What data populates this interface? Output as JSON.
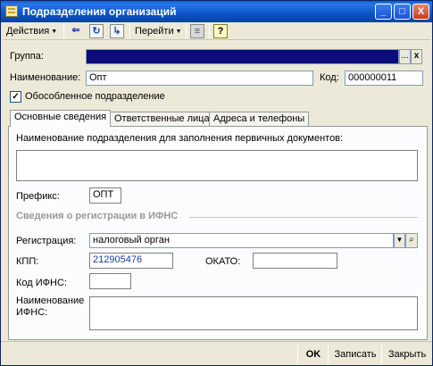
{
  "window": {
    "title": "Подразделения организаций",
    "minimize": "_",
    "maximize": "□",
    "close": "X"
  },
  "toolbar": {
    "actions_label": "Действия",
    "goto_label": "Перейти",
    "help_label": "?",
    "icons": [
      "arrow-left-icon",
      "refresh-icon",
      "structure-icon",
      "list-icon",
      "help-icon"
    ]
  },
  "form": {
    "group_label": "Группа:",
    "group_value": "",
    "group_select_btn": "...",
    "group_clear_btn": "x",
    "name_label": "Наименование:",
    "name_value": "Опт",
    "code_label": "Код:",
    "code_value": "000000011",
    "separate_checkbox_label": "Обособленное подразделение",
    "separate_checked": true
  },
  "tabs": [
    {
      "label": "Основные сведения"
    },
    {
      "label": "Ответственные лица"
    },
    {
      "label": "Адреса и телефоны"
    }
  ],
  "main": {
    "docs_name_label": "Наименование подразделения для заполнения первичных документов:",
    "docs_name_value": "",
    "prefix_label": "Префикс:",
    "prefix_value": "ОПТ",
    "section_title": "Сведения о регистрации в ИФНС",
    "registration_label": "Регистрация:",
    "registration_value": "налоговый орган",
    "kpp_label": "КПП:",
    "kpp_value": "212905476",
    "okato_label": "ОКАТО:",
    "okato_value": "",
    "ifns_code_label": "Код ИФНС:",
    "ifns_code_value": "",
    "ifns_name_label_1": "Наименование",
    "ifns_name_label_2": "ИФНС:",
    "ifns_name_value": ""
  },
  "buttons": {
    "ok": "OK",
    "save": "Записать",
    "close": "Закрыть"
  },
  "colors": {
    "titlebar": "#0b54c8",
    "window_bg": "#ece9d8",
    "group_field": "#0b0b7a",
    "kpp_text": "#1a3aa0"
  }
}
